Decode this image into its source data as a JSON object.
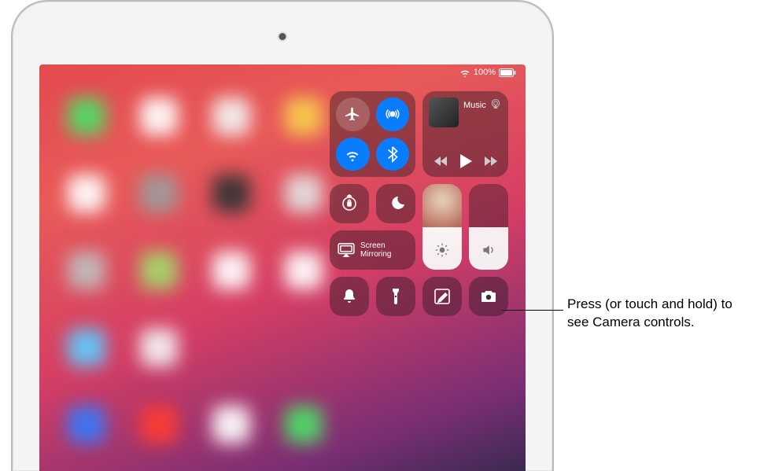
{
  "status": {
    "battery_percent": "100%"
  },
  "control_center": {
    "connectivity": {
      "airplane": "airplane-icon",
      "airdrop": "airdrop-icon",
      "wifi": "wifi-icon",
      "bluetooth": "bluetooth-icon",
      "wifi_active": true,
      "bluetooth_active": true,
      "airdrop_active": true,
      "airplane_active": false
    },
    "music": {
      "app_label": "Music",
      "back": "backward-icon",
      "play": "play-icon",
      "forward": "forward-icon",
      "airplay": "airplay-audio-icon"
    },
    "rotation_lock": "rotation-lock-icon",
    "do_not_disturb": "moon-icon",
    "screen_mirroring_label": "Screen Mirroring",
    "brightness_level": 0.5,
    "volume_level": 0.5,
    "silent": "bell-icon",
    "flashlight": "flashlight-icon",
    "notes": "compose-icon",
    "camera": "camera-icon"
  },
  "callout": {
    "text": "Press (or touch and hold) to see Camera controls."
  }
}
